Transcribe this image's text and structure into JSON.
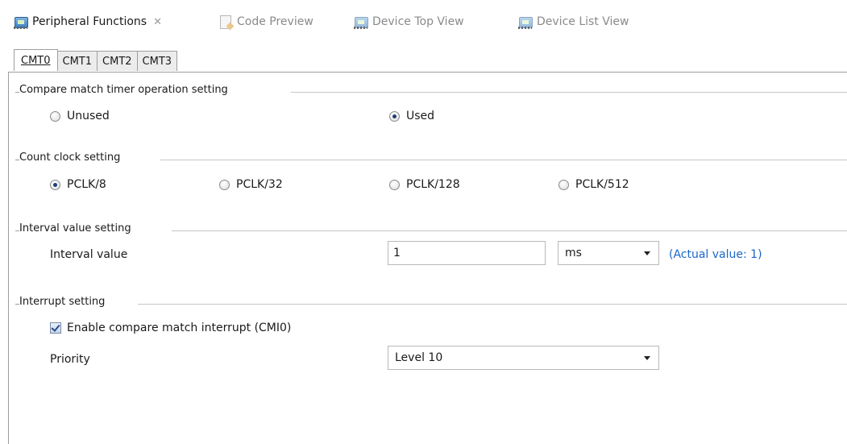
{
  "editor_tabs": [
    {
      "label": "Peripheral Functions",
      "active": true,
      "icon": "chip-icon",
      "close": "✕"
    },
    {
      "label": "Code Preview",
      "active": false,
      "icon": "document-edit-icon"
    },
    {
      "label": "Device Top View",
      "active": false,
      "icon": "chip-icon"
    },
    {
      "label": "Device List View",
      "active": false,
      "icon": "chip-icon"
    }
  ],
  "sub_tabs": [
    {
      "label": "CMT0",
      "active": true
    },
    {
      "label": "CMT1",
      "active": false
    },
    {
      "label": "CMT2",
      "active": false
    },
    {
      "label": "CMT3",
      "active": false
    }
  ],
  "groups": {
    "operation": {
      "title": "Compare match timer operation setting",
      "options": [
        {
          "label": "Unused",
          "selected": false
        },
        {
          "label": "Used",
          "selected": true
        }
      ]
    },
    "clock": {
      "title": "Count clock setting",
      "options": [
        {
          "label": "PCLK/8",
          "selected": true
        },
        {
          "label": "PCLK/32",
          "selected": false
        },
        {
          "label": "PCLK/128",
          "selected": false
        },
        {
          "label": "PCLK/512",
          "selected": false
        }
      ]
    },
    "interval": {
      "title": "Interval value setting",
      "field_label": "Interval value",
      "value": "1",
      "unit": "ms",
      "actual": "(Actual value: 1)"
    },
    "interrupt": {
      "title": "Interrupt setting",
      "enable_label": "Enable compare match interrupt (CMI0)",
      "enable_checked": true,
      "priority_label": "Priority",
      "priority_value": "Level 10"
    }
  },
  "colors": {
    "accent_link": "#1a66c8",
    "radio_dot": "#1f3e74"
  }
}
